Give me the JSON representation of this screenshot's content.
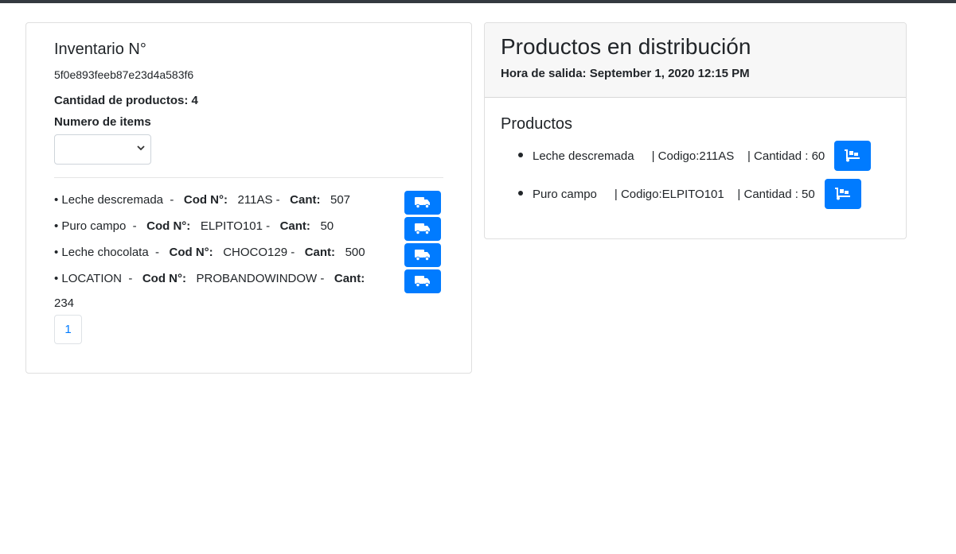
{
  "inventory": {
    "title": "Inventario N°",
    "id": "5f0e893feeb87e23d4a583f6",
    "quantity_label": "Cantidad de productos: 4",
    "items_label": "Numero de items",
    "select_value": "",
    "cod_label": "Cod N°:",
    "cant_label": "Cant:",
    "items": [
      {
        "name": "Leche descremada",
        "code": "211AS",
        "qty": "507"
      },
      {
        "name": "Puro campo",
        "code": "ELPITO101",
        "qty": "50"
      },
      {
        "name": "Leche chocolata",
        "code": "CHOCO129",
        "qty": "500"
      },
      {
        "name": "LOCATION",
        "code": "PROBANDOWINDOW",
        "qty": "234"
      }
    ],
    "page": "1"
  },
  "distribution": {
    "title": "Productos en distribución",
    "departure": "Hora de salida: September 1, 2020 12:15 PM",
    "products_title": "Productos",
    "items": [
      {
        "name": "Leche descremada",
        "code": "| Codigo:211AS",
        "qty": "| Cantidad : 60"
      },
      {
        "name": "Puro campo",
        "code": "| Codigo:ELPITO101",
        "qty": "| Cantidad : 50"
      }
    ]
  },
  "colors": {
    "accent": "#007bff",
    "topbar": "#343a40"
  },
  "icons": {
    "send": "truck-icon",
    "unload": "dolly-icon",
    "dropdown": "chevron-down-icon"
  }
}
